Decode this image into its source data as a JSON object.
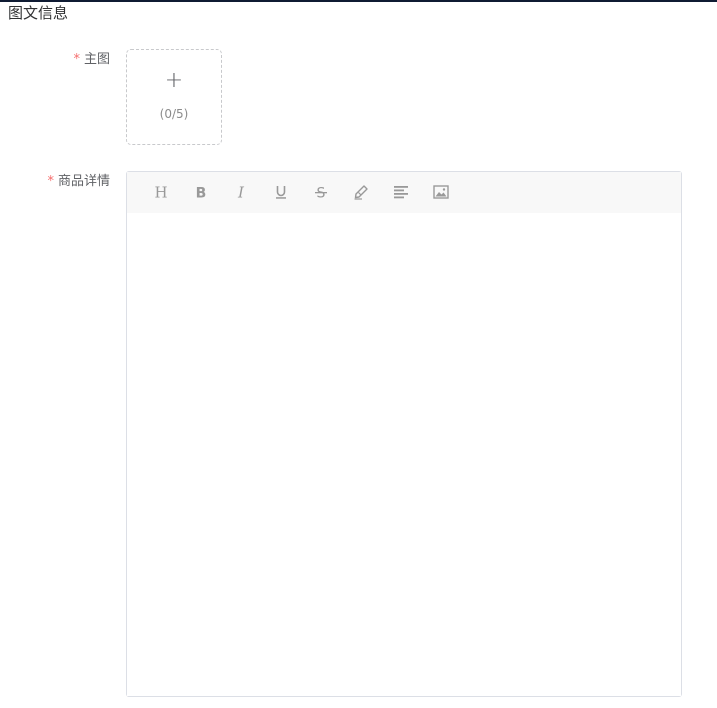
{
  "section": {
    "title": "图文信息"
  },
  "form": {
    "main_image": {
      "required_mark": "*",
      "label": "主图",
      "upload": {
        "plus": "+",
        "count": "(0/5)"
      }
    },
    "detail": {
      "required_mark": "*",
      "label": "商品详情",
      "toolbar": [
        {
          "name": "heading-icon"
        },
        {
          "name": "bold-icon"
        },
        {
          "name": "italic-icon"
        },
        {
          "name": "underline-icon"
        },
        {
          "name": "strikethrough-icon"
        },
        {
          "name": "pen-icon"
        },
        {
          "name": "align-icon"
        },
        {
          "name": "image-icon"
        }
      ]
    }
  },
  "colors": {
    "required": "#f56c6c",
    "toolbar_bg": "#f8f8f8",
    "icon": "#999999",
    "border": "#dcdfe6"
  }
}
